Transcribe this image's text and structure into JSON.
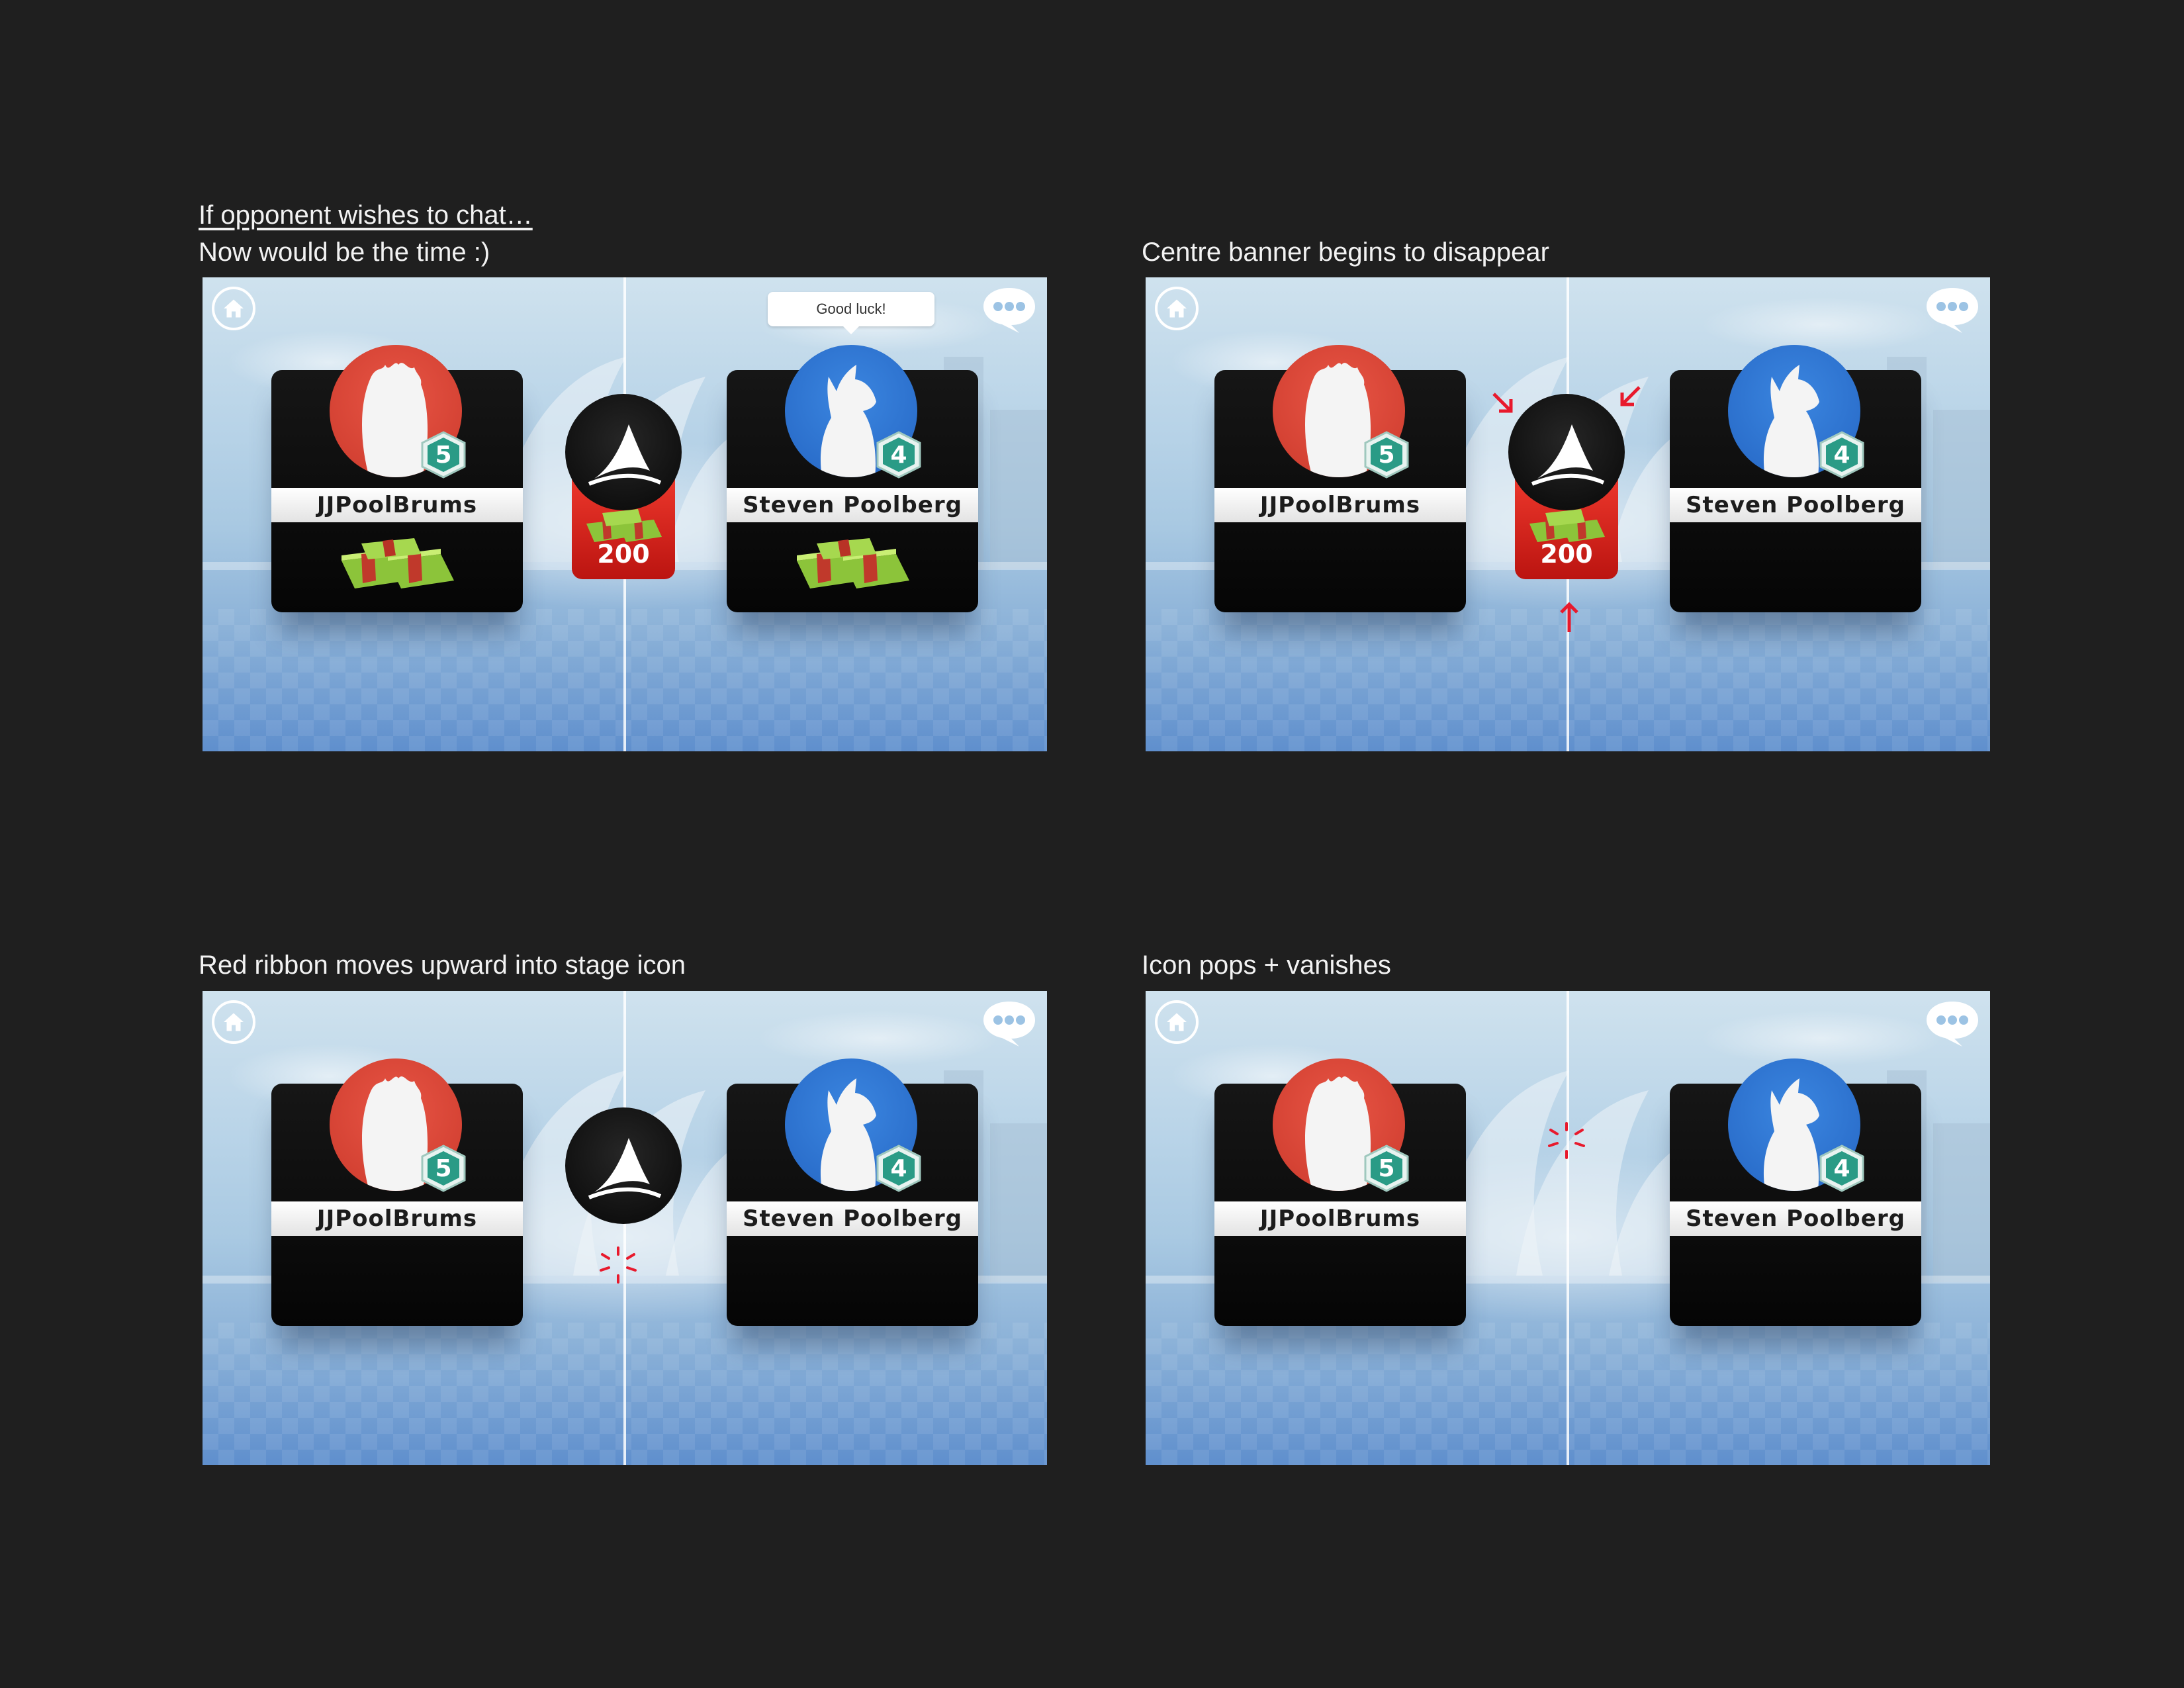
{
  "captions": {
    "chat_link": "If opponent wishes to chat…",
    "frame1": "Now would be the time :)",
    "frame2": "Centre banner begins to disappear",
    "frame3": "Red ribbon moves upward into stage icon",
    "frame4": "Icon pops + vanishes"
  },
  "players": {
    "left": {
      "name": "JJPoolBrums",
      "level": "5",
      "avatar_icon": "flame-silhouette-icon",
      "avatar_color": "#d9463a"
    },
    "right": {
      "name": "Steven Poolberg",
      "level": "4",
      "avatar_icon": "howling-wolf-icon",
      "avatar_color": "#2f78d6"
    }
  },
  "stake": {
    "value": "200",
    "icon": "cash-stack-icon",
    "ribbon_color": "#d8231c"
  },
  "chat": {
    "message": "Good luck!"
  },
  "icons": {
    "home": "home-icon",
    "chat": "chat-bubble-icon",
    "stage": "shark-fin-icon",
    "level": "hexagon-level-badge-icon"
  },
  "colors": {
    "background": "#1f1f1f",
    "level_badge": "#2a9b86",
    "annotation_red": "#e8192c"
  }
}
